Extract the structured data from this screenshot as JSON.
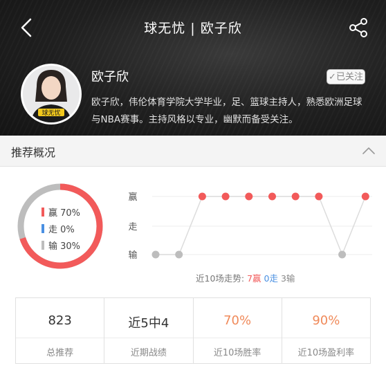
{
  "header": {
    "title": "球无忧 | 欧子欣"
  },
  "profile": {
    "name": "欧子欣",
    "follow_label": "✓已关注",
    "bio": "欧子欣，伟伦体育学院大学毕业，足、篮球主持人，熟悉欧洲足球与NBA赛事。主持风格以专业，幽默而备受关注。",
    "avatar_text": "球无忧"
  },
  "section": {
    "title": "推荐概况"
  },
  "ratio": {
    "win_label": "赢 70%",
    "draw_label": "走 0%",
    "loss_label": "输 30%",
    "win": 70,
    "draw": 0,
    "loss": 30,
    "colors": {
      "win": "#f25a5a",
      "draw": "#4a90e2",
      "loss": "#bdbdbd"
    }
  },
  "chart_data": {
    "type": "line",
    "categories": [
      "赢",
      "走",
      "输"
    ],
    "x": [
      1,
      2,
      3,
      4,
      5,
      6,
      7,
      8,
      9,
      10
    ],
    "values": [
      "输",
      "输",
      "赢",
      "赢",
      "赢",
      "赢",
      "赢",
      "赢",
      "输",
      "赢"
    ],
    "y_axis_labels": [
      "赢",
      "走",
      "输"
    ]
  },
  "trend": {
    "summary_prefix": "近10场走势:",
    "win_text": "7赢",
    "draw_text": "0走",
    "loss_text": "3输"
  },
  "stats": [
    {
      "value": "823",
      "label": "总推荐",
      "highlight": false
    },
    {
      "value": "近5中4",
      "label": "近期战绩",
      "highlight": false
    },
    {
      "value": "70%",
      "label": "近10场胜率",
      "highlight": true
    },
    {
      "value": "90%",
      "label": "近10场盈利率",
      "highlight": true
    }
  ],
  "accent_colors": {
    "win": "#f25a5a",
    "loss": "#bdbdbd",
    "orange": "#f08a5a"
  }
}
